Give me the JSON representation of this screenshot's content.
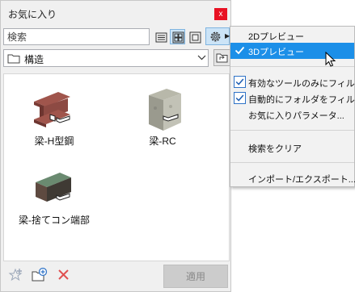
{
  "panel": {
    "title": "お気に入り",
    "close_label": "x",
    "search_placeholder": "検索",
    "folder": {
      "label": "構造"
    },
    "items": [
      {
        "label": "梁-H型鋼",
        "icon": "h-beam-icon"
      },
      {
        "label": "梁-RC",
        "icon": "rc-beam-icon"
      },
      {
        "label": "梁-捨てコン端部",
        "icon": "concrete-beam-end-icon"
      }
    ],
    "apply_label": "適用"
  },
  "menu": {
    "items": [
      {
        "label": "2Dプレビュー",
        "checked": false,
        "highlighted": false
      },
      {
        "label": "3Dプレビュー",
        "checked": true,
        "highlighted": true
      },
      {
        "label": "有効なツールのみにフィルタ",
        "checked": true,
        "highlighted": false
      },
      {
        "label": "自動的にフォルダをフィルタ",
        "checked": true,
        "highlighted": false
      },
      {
        "label": "お気に入りパラメータ...",
        "checked": false,
        "highlighted": false
      },
      {
        "label": "検索をクリア",
        "checked": false,
        "highlighted": false
      },
      {
        "label": "インポート/エクスポート...",
        "checked": false,
        "highlighted": false
      }
    ]
  },
  "colors": {
    "highlight": "#1c8fe8",
    "close_button": "#e81123",
    "view_active": "#cce4f7",
    "delete_icon": "#e05050"
  }
}
